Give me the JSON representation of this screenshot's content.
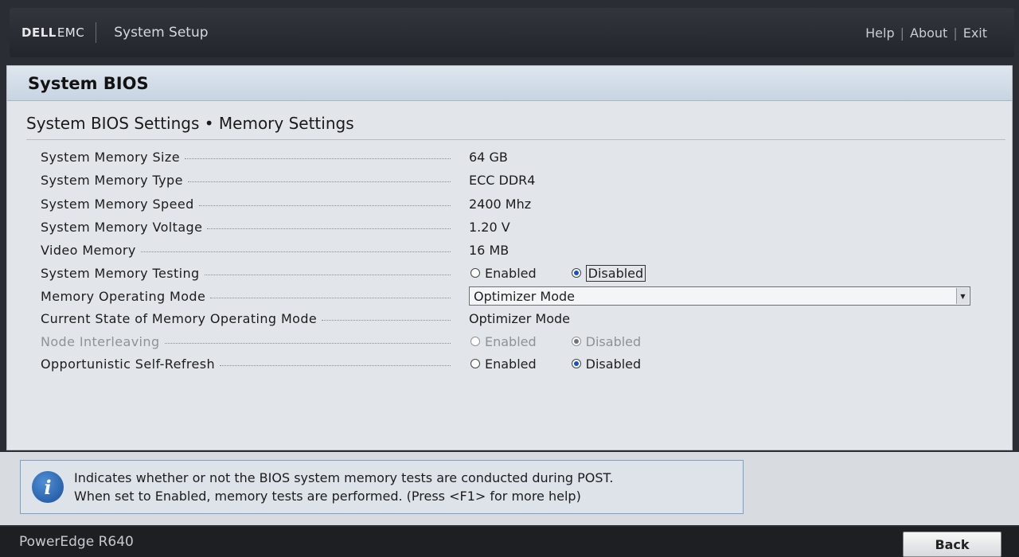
{
  "header": {
    "logo_dell": "DELL",
    "logo_emc": "EMC",
    "app_title": "System Setup",
    "links": [
      "Help",
      "About",
      "Exit"
    ]
  },
  "panel": {
    "title": "System BIOS",
    "subtitle": "System BIOS Settings • Memory Settings"
  },
  "settings": {
    "memory_size": {
      "label": "System Memory Size",
      "value": "64 GB"
    },
    "memory_type": {
      "label": "System Memory Type",
      "value": "ECC DDR4"
    },
    "memory_speed": {
      "label": "System Memory Speed",
      "value": "2400 Mhz"
    },
    "memory_voltage": {
      "label": "System Memory Voltage",
      "value": "1.20 V"
    },
    "video_memory": {
      "label": "Video Memory",
      "value": "16 MB"
    },
    "memory_testing": {
      "label": "System Memory Testing",
      "opt1": "Enabled",
      "opt2": "Disabled",
      "selected": "Disabled"
    },
    "operating_mode": {
      "label": "Memory Operating Mode",
      "value": "Optimizer Mode"
    },
    "current_mode": {
      "label": "Current State of Memory Operating Mode",
      "value": "Optimizer Mode"
    },
    "node_interleaving": {
      "label": "Node Interleaving",
      "opt1": "Enabled",
      "opt2": "Disabled",
      "selected": "Disabled"
    },
    "self_refresh": {
      "label": "Opportunistic Self-Refresh",
      "opt1": "Enabled",
      "opt2": "Disabled",
      "selected": "Disabled"
    }
  },
  "help": {
    "line1": "Indicates whether or not the BIOS system memory tests are conducted during POST.",
    "line2": "When set to Enabled, memory tests are performed. (Press <F1> for more help)"
  },
  "footer": {
    "model": "PowerEdge R640",
    "back_label": "Back"
  },
  "colors": {
    "accent": "#1750c8",
    "panel_header": "#c7d4e2",
    "help_border": "#7aa0c8"
  }
}
